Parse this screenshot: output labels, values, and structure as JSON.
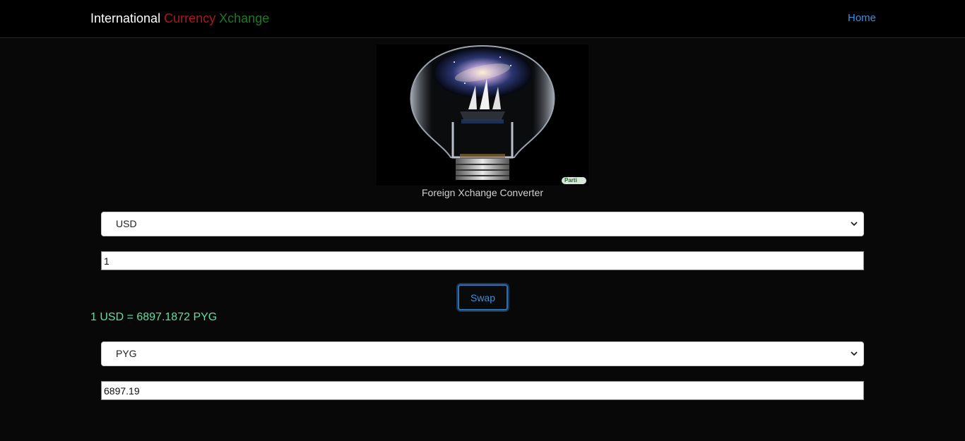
{
  "navbar": {
    "brand_part1": "International",
    "brand_part2": "Currency",
    "brand_part3": "Xchange",
    "home_link": "Home"
  },
  "hero": {
    "caption": "Foreign Xchange Converter",
    "badge": "Parti"
  },
  "from": {
    "currency": "USD",
    "amount": "1"
  },
  "swap_label": "Swap",
  "rate_text": "1 USD = 6897.1872 PYG",
  "to": {
    "currency": "PYG",
    "amount": "6897.19"
  },
  "colors": {
    "background": "#080808",
    "link": "#3d8fd8",
    "brand_red": "#b0161b",
    "brand_green": "#1c7a22",
    "rate": "#5de0a0"
  }
}
